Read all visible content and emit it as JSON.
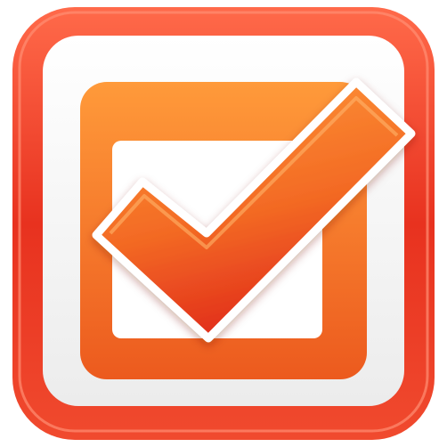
{
  "icon": {
    "name": "checkbox-checked-icon",
    "state": "checked",
    "colors": {
      "frame_outer": "#e0301e",
      "frame_highlight": "#ff7a5c",
      "frame_inner_bg": "#f7f7f7",
      "box_fill_light": "#ff8a2a",
      "box_fill_dark": "#e8471c",
      "box_inner": "#ffffff",
      "check_light": "#ff9233",
      "check_dark": "#e2301c",
      "check_outline": "#ffffff"
    }
  }
}
